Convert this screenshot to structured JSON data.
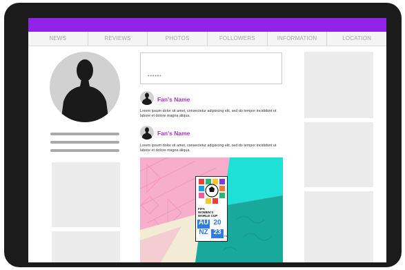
{
  "nav": {
    "items": [
      "NEWS",
      "REVIEWS",
      "PHOTOS",
      "FOLLOWERS",
      "INFORMATION",
      "LOCATION"
    ]
  },
  "composer": {
    "placeholder": "••••••"
  },
  "posts": [
    {
      "author": "Fan's Name",
      "text": "Lorem ipsum dolor sit amet, consectetur adipiscing elit, sed do tempor incididunt ut labore et dolore magna aliqua."
    },
    {
      "author": "Fan's Name",
      "text": "Lorem ipsum dolor sit amet, consectetur adipiscing elit, sed do tempor incididunt ut labore et dolore magna aliqua."
    }
  ],
  "poster": {
    "fifa": "FIFA",
    "womens": "WOMEN'S",
    "world_cup": "WORLD CUP",
    "au": "AU",
    "nz": "NZ",
    "year_top": "20",
    "year_bottom": "23",
    "tm": "TM"
  },
  "colors": {
    "topbar": "#8f24e8",
    "fan_name": "#b02fc6",
    "teal": "#19a99c",
    "cyan": "#1ee0d6",
    "pink": "#f6aecb",
    "cream": "#f2ecd6"
  },
  "icons": [
    "person-silhouette-icon"
  ]
}
